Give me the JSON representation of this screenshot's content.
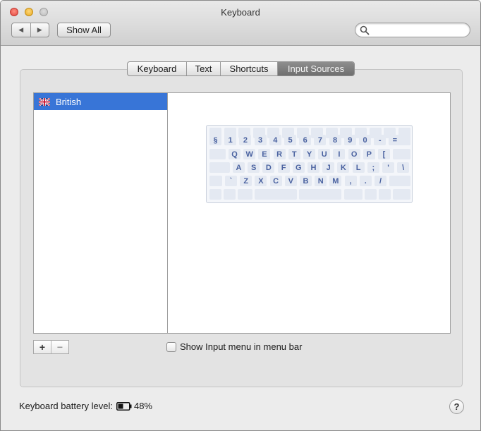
{
  "window": {
    "title": "Keyboard"
  },
  "toolbar": {
    "back_icon": "back-arrow-icon",
    "forward_icon": "forward-arrow-icon",
    "show_all_label": "Show All",
    "search_placeholder": "",
    "search_value": ""
  },
  "tabs": [
    {
      "label": "Keyboard",
      "active": false
    },
    {
      "label": "Text",
      "active": false
    },
    {
      "label": "Shortcuts",
      "active": false
    },
    {
      "label": "Input Sources",
      "active": true
    }
  ],
  "input_sources": {
    "items": [
      {
        "label": "British",
        "icon": "uk-flag-icon",
        "selected": true
      }
    ],
    "add_label": "+",
    "remove_label": "−"
  },
  "keyboard_preview": {
    "rows": [
      [
        "§",
        "1",
        "2",
        "3",
        "4",
        "5",
        "6",
        "7",
        "8",
        "9",
        "0",
        "-",
        "="
      ],
      [
        "Q",
        "W",
        "E",
        "R",
        "T",
        "Y",
        "U",
        "I",
        "O",
        "P",
        "[",
        "]"
      ],
      [
        "A",
        "S",
        "D",
        "F",
        "G",
        "H",
        "J",
        "K",
        "L",
        ";",
        "'",
        "\\"
      ],
      [
        "`",
        "Z",
        "X",
        "C",
        "V",
        "B",
        "N",
        "M",
        ",",
        ".",
        "/"
      ]
    ]
  },
  "show_input_menu": {
    "label": "Show Input menu in menu bar",
    "checked": false
  },
  "battery": {
    "label": "Keyboard battery level:",
    "percent": "48%",
    "level": 0.48
  },
  "help_label": "?",
  "colors": {
    "selection": "#3875d7",
    "key_text": "#4a62a0",
    "active_tab": "#7a7a7a"
  }
}
